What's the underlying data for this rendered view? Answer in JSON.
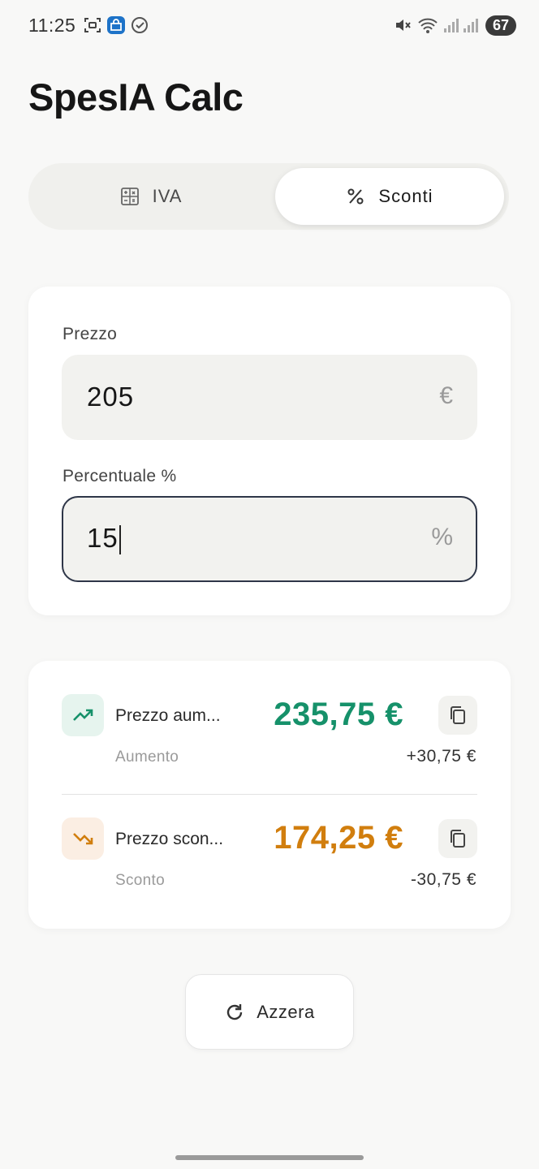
{
  "status_bar": {
    "time": "11:25",
    "battery": "67",
    "icons": [
      "screenshot-icon",
      "store-app-icon",
      "check-circle-icon",
      "mute-icon",
      "wifi-icon",
      "signal-icon",
      "signal-icon-2"
    ]
  },
  "app": {
    "title": "SpesIA Calc"
  },
  "tabs": [
    {
      "label": "IVA",
      "icon": "calculator-icon",
      "selected": false
    },
    {
      "label": "Sconti",
      "icon": "percent-icon",
      "selected": true
    }
  ],
  "inputs": {
    "price": {
      "label": "Prezzo",
      "value": "205",
      "suffix": "€"
    },
    "percentage": {
      "label": "Percentuale %",
      "value": "15",
      "suffix": "%"
    }
  },
  "results": {
    "increase": {
      "label": "Prezzo aum...",
      "value": "235,75 €",
      "sub_label": "Aumento",
      "diff": "+30,75 €",
      "color": "#16916a",
      "icon_bg": "#e6f4ee",
      "icon": "trending-up-icon"
    },
    "discount": {
      "label": "Prezzo scon...",
      "value": "174,25 €",
      "sub_label": "Sconto",
      "diff": "-30,75 €",
      "color": "#d17e0e",
      "icon_bg": "#fbeee3",
      "icon": "trending-down-icon"
    }
  },
  "reset_button": {
    "label": "Azzera",
    "icon": "refresh-icon"
  }
}
